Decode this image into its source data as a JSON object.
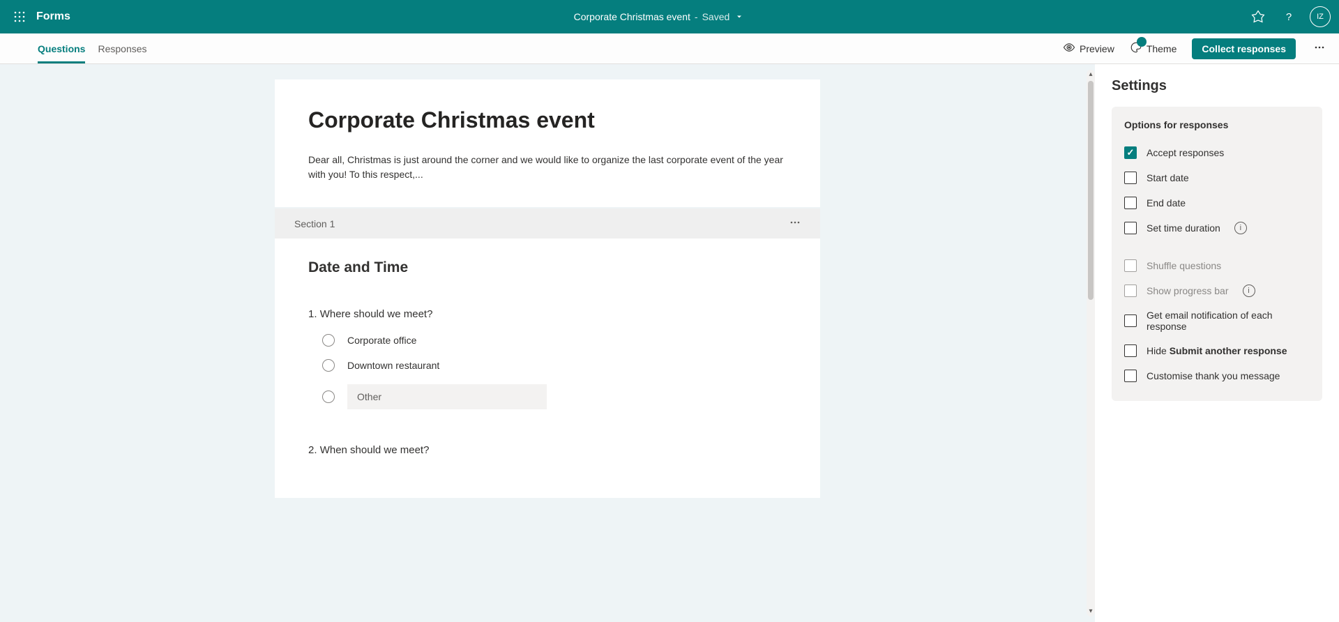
{
  "header": {
    "app_name": "Forms",
    "form_title": "Corporate Christmas event",
    "status_sep": "-",
    "status": "Saved",
    "avatar": "IZ"
  },
  "toolbar": {
    "tabs": {
      "questions": "Questions",
      "responses": "Responses"
    },
    "preview": "Preview",
    "theme": "Theme",
    "collect": "Collect responses"
  },
  "form": {
    "title": "Corporate Christmas event",
    "description": "Dear all, Christmas is just around the corner and we would like to organize the last corporate event of the year with you! To this respect,...",
    "section_label": "Section 1",
    "section_title": "Date and Time",
    "q1": {
      "prefix": "1.",
      "text": "Where should we meet?",
      "opt1": "Corporate office",
      "opt2": "Downtown restaurant",
      "other_placeholder": "Other"
    },
    "q2": {
      "prefix": "2.",
      "text": "When should we meet?"
    }
  },
  "sidebar": {
    "title": "Settings",
    "panel_title": "Options for responses",
    "accept": "Accept responses",
    "start_date": "Start date",
    "end_date": "End date",
    "time_duration": "Set time duration",
    "shuffle": "Shuffle questions",
    "progress": "Show progress bar",
    "email_notif": "Get email notification of each response",
    "hide_prefix": "Hide ",
    "hide_bold": "Submit another response",
    "custom_thanks": "Customise thank you message"
  }
}
